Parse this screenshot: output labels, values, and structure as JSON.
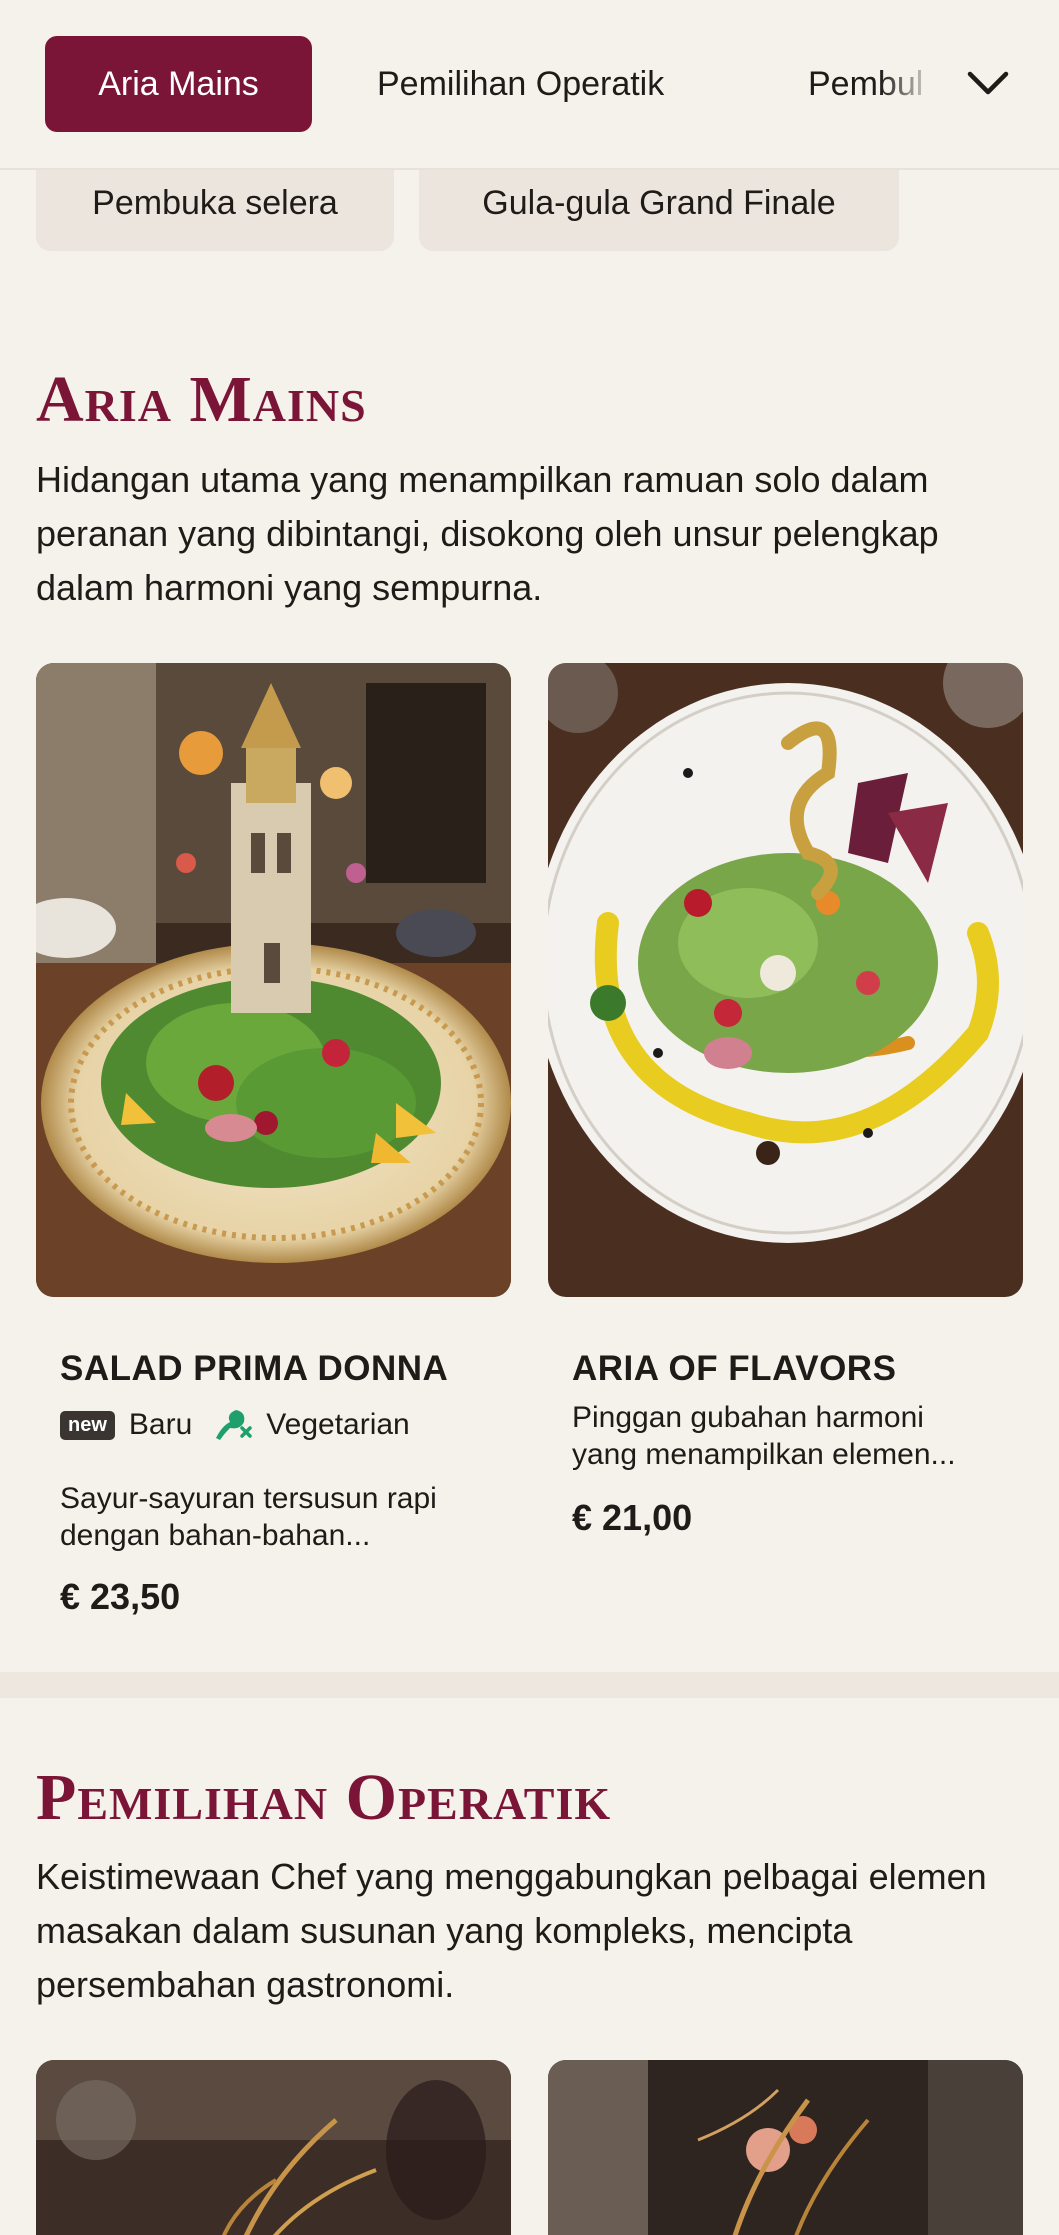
{
  "nav": {
    "tabs": [
      {
        "label": "Aria Mains",
        "active": true
      },
      {
        "label": "Pemilihan Operatik",
        "active": false
      },
      {
        "label": "Pembuka selera",
        "visible_text": "Pembul"
      }
    ],
    "chips": [
      {
        "label": "Pembuka selera"
      },
      {
        "label": "Gula-gula Grand Finale"
      }
    ],
    "more_icon": "chevron-down-icon"
  },
  "sections": [
    {
      "title": "Aria Mains",
      "description": "Hidangan utama yang menampilkan ramuan solo dalam peranan yang dibintangi, disokong oleh unsur pelengkap dalam harmoni yang sempurna.",
      "items": [
        {
          "name": "SALAD PRIMA DONNA",
          "tags": [
            {
              "badge": "new",
              "label": "Baru"
            },
            {
              "icon": "vegetarian-icon",
              "label": "Vegetarian"
            }
          ],
          "description": "Sayur-sayuran tersusun rapi dengan bahan-bahan...",
          "price": "€ 23,50"
        },
        {
          "name": "ARIA OF FLAVORS",
          "description": "Pinggan gubahan harmoni yang menampilkan elemen...",
          "price": "€ 21,00"
        }
      ]
    },
    {
      "title": "Pemilihan Operatik",
      "description": "Keistimewaan Chef yang menggabungkan pelbagai elemen masakan dalam susunan yang kompleks, mencipta persembahan gastronomi."
    }
  ],
  "colors": {
    "accent": "#7b1538",
    "background": "#f5f1eb",
    "chip": "#ebe5de",
    "veg_green": "#1fa06b"
  }
}
